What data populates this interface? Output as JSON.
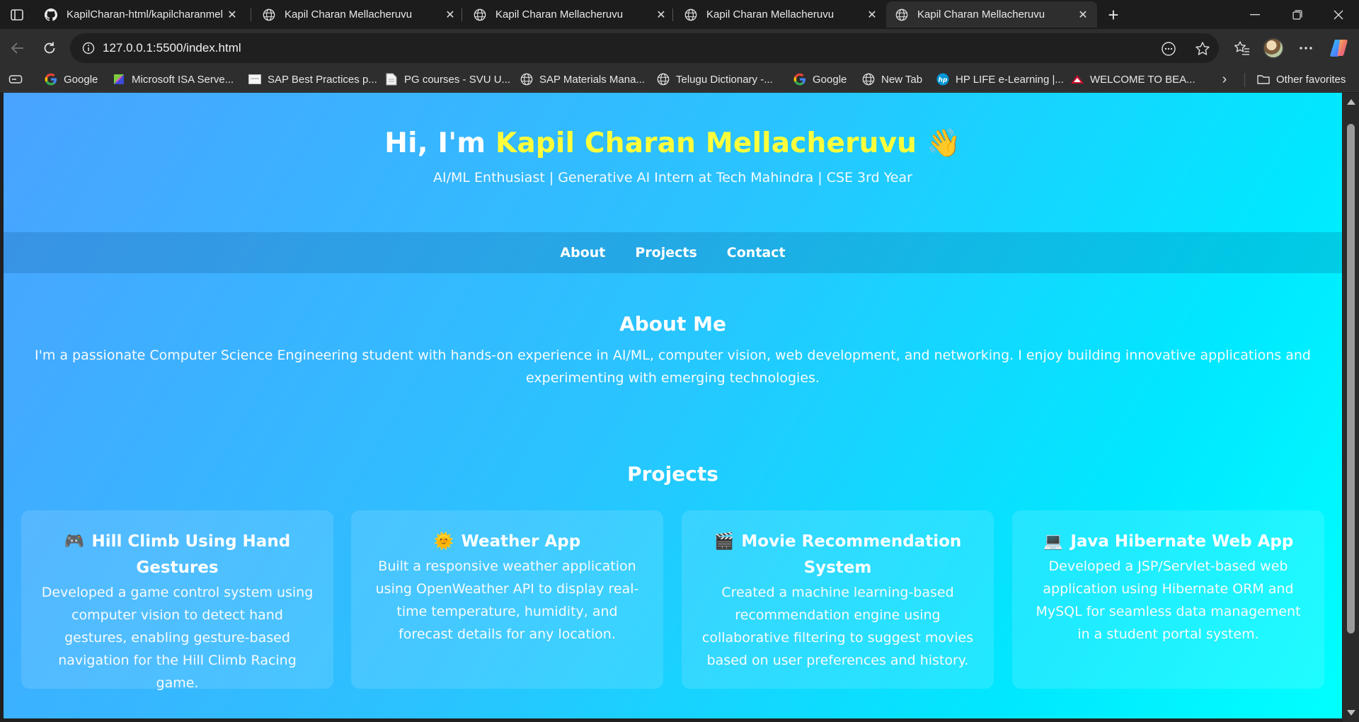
{
  "browser": {
    "tabs": [
      {
        "title": "KapilCharan-html/kapilcharanmel",
        "favicon": "github-icon",
        "active": false
      },
      {
        "title": "Kapil Charan Mellacheruvu",
        "favicon": "globe-icon",
        "active": false
      },
      {
        "title": "Kapil Charan Mellacheruvu",
        "favicon": "globe-icon",
        "active": false
      },
      {
        "title": "Kapil Charan Mellacheruvu",
        "favicon": "globe-icon",
        "active": false
      },
      {
        "title": "Kapil Charan Mellacheruvu",
        "favicon": "globe-icon",
        "active": true
      }
    ],
    "url": "127.0.0.1:5500/index.html",
    "bookmarks": [
      {
        "label": "Google",
        "icon": "google-icon"
      },
      {
        "label": "Microsoft ISA Serve...",
        "icon": "isa-icon"
      },
      {
        "label": "SAP Best Practices p...",
        "icon": "page-icon"
      },
      {
        "label": "PG courses - SVU U...",
        "icon": "doc-icon"
      },
      {
        "label": "SAP Materials Mana...",
        "icon": "globe-icon"
      },
      {
        "label": "Telugu Dictionary -...",
        "icon": "globe-icon"
      },
      {
        "label": "Google",
        "icon": "google-icon"
      },
      {
        "label": "New Tab",
        "icon": "globe-icon"
      },
      {
        "label": "HP LIFE e-Learning |...",
        "icon": "hp-icon"
      },
      {
        "label": "WELCOME TO BEA...",
        "icon": "bea-icon"
      }
    ],
    "other_favorites": "Other favorites"
  },
  "page": {
    "hero": {
      "greeting": "Hi, I'm ",
      "name": "Kapil Charan Mellacheruvu",
      "wave": "👋",
      "tagline": "AI/ML Enthusiast | Generative AI Intern at Tech Mahindra | CSE 3rd Year"
    },
    "nav": [
      "About",
      "Projects",
      "Contact"
    ],
    "about": {
      "heading": "About Me",
      "text": "I'm a passionate Computer Science Engineering student with hands-on experience in AI/ML, computer vision, web development, and networking. I enjoy building innovative applications and experimenting with emerging technologies."
    },
    "projects": {
      "heading": "Projects",
      "items": [
        {
          "emoji": "🎮",
          "title": "Hill Climb Using Hand Gestures",
          "description": "Developed a game control system using computer vision to detect hand gestures, enabling gesture-based navigation for the Hill Climb Racing game."
        },
        {
          "emoji": "🌞",
          "title": "Weather App",
          "description": "Built a responsive weather application using OpenWeather API to display real-time temperature, humidity, and forecast details for any location."
        },
        {
          "emoji": "🎬",
          "title": "Movie Recommendation System",
          "description": "Created a machine learning-based recommendation engine using collaborative filtering to suggest movies based on user preferences and history."
        },
        {
          "emoji": "💻",
          "title": "Java Hibernate Web App",
          "description": "Developed a JSP/Servlet-based web application using Hibernate ORM and MySQL for seamless data management in a student portal system."
        }
      ]
    }
  },
  "colors": {
    "name_highlight": "#ffff3b",
    "gradient_start": "#4aa3ff",
    "gradient_end": "#00ffff"
  }
}
